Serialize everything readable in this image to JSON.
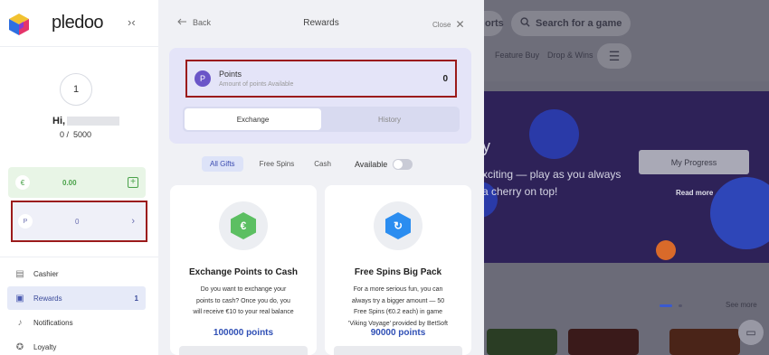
{
  "sidebar": {
    "brand": "pledoo",
    "level": "1",
    "greeting": "Hi,",
    "progress_current": "0",
    "progress_total": "5000",
    "wallet_currency_symbol": "€",
    "wallet_amount": "0.00",
    "points_symbol": "P",
    "points_amount": "0",
    "menu": [
      {
        "label": "Cashier",
        "icon": "cashier-icon"
      },
      {
        "label": "Rewards",
        "icon": "gift-icon",
        "badge": "1"
      },
      {
        "label": "Notifications",
        "icon": "bell-icon"
      },
      {
        "label": "Loyalty",
        "icon": "star-icon"
      }
    ]
  },
  "panel": {
    "back_label": "Back",
    "title": "Rewards",
    "close_label": "Close",
    "points_label": "Points",
    "points_sub": "Amount of points Available",
    "points_value": "0",
    "points_icon_letter": "P",
    "tabs": [
      "Exchange",
      "History"
    ],
    "filters": [
      "All Gifts",
      "Free Spins",
      "Cash"
    ],
    "available_label": "Available",
    "gifts": [
      {
        "title": "Exchange Points to Cash",
        "desc": [
          "Do you want to exchange your",
          "points to cash? Once you do, you",
          "will receive €10 to your real balance"
        ],
        "price": "100000 points",
        "icon_glyph": "€",
        "color": "#5cbf62"
      },
      {
        "title": "Free Spins Big Pack",
        "desc": [
          "For a more serious fun, you can",
          "always try a bigger amount — 50",
          "Free Spins (€0.2 each) in game",
          "'Viking Voyage' provided by BetSoft"
        ],
        "price": "90000 points",
        "icon_glyph": "↻",
        "color": "#2b8df0"
      }
    ]
  },
  "background": {
    "tab_partial": "orts",
    "search_placeholder": "Search for a game",
    "nav": [
      "Feature Buy",
      "Drop & Wins"
    ],
    "banner_line1": "xciting — play as you always",
    "banner_line2": "a cherry on top!",
    "banner_letter": "y",
    "progress_button": "My Progress",
    "read_more": "Read more",
    "see_more": "See more"
  }
}
